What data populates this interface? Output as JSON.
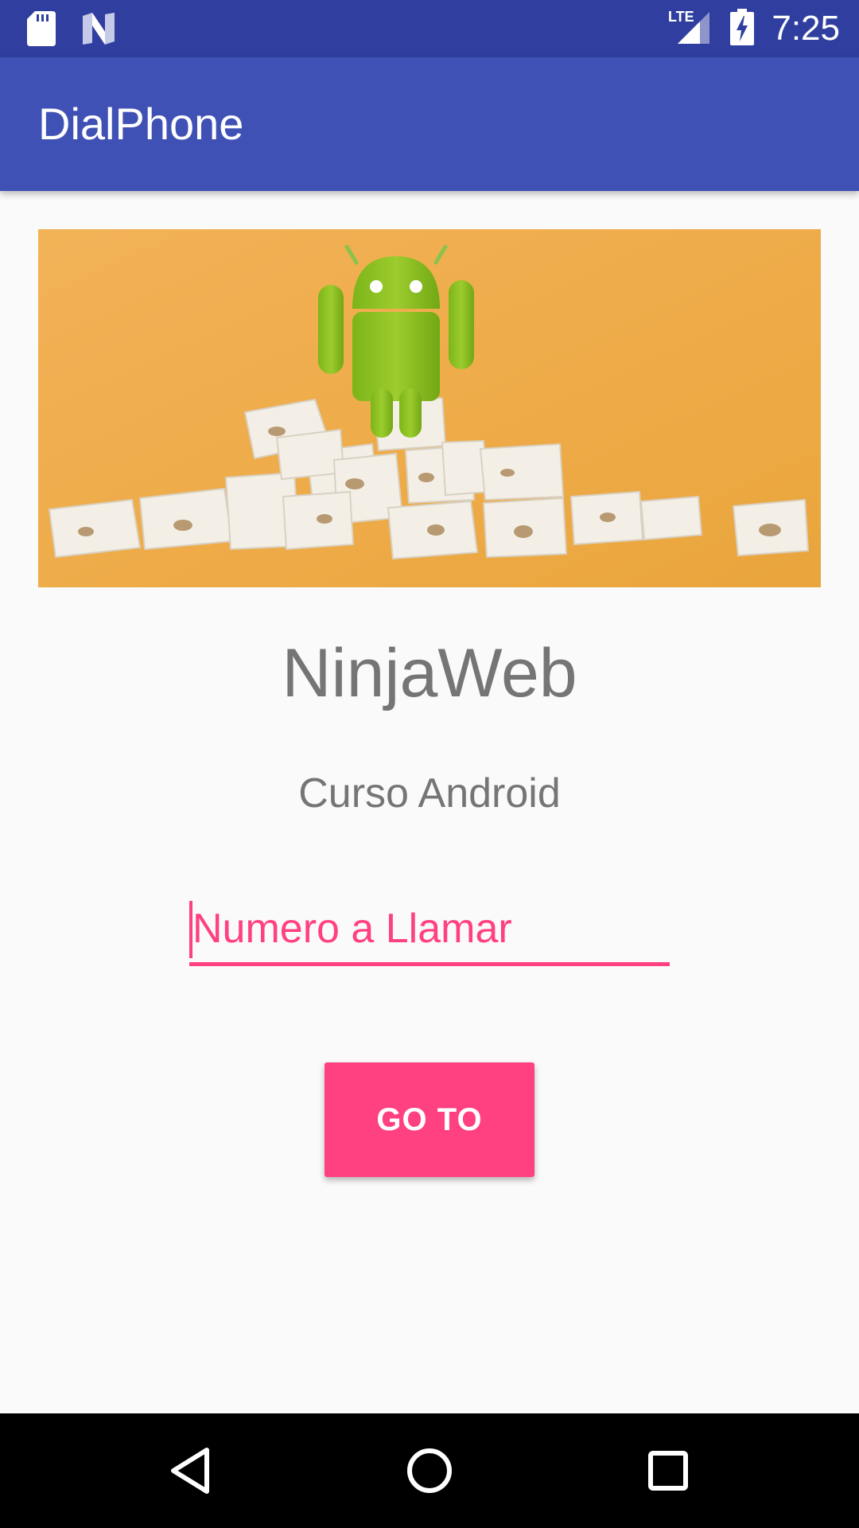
{
  "status_bar": {
    "time": "7:25",
    "network_label": "LTE",
    "icons": [
      "sd-card-icon",
      "n-logo-icon",
      "lte-signal-icon",
      "battery-charging-icon"
    ]
  },
  "app_bar": {
    "title": "DialPhone"
  },
  "hero_image": {
    "description_icon": "android-nougat-image"
  },
  "main": {
    "brand_title": "NinjaWeb",
    "subtitle": "Curso Android",
    "phone_input": {
      "placeholder": "Numero a Llamar",
      "value": ""
    },
    "go_button_label": "GO TO"
  },
  "nav_bar": {
    "icons": [
      "back-icon",
      "home-icon",
      "recents-icon"
    ]
  },
  "colors": {
    "status_bar": "#303f9f",
    "app_bar": "#3f51b5",
    "accent": "#ff4081",
    "hero_background": "#f0ad48",
    "android_green": "#8bc34a",
    "text_secondary": "#757575"
  }
}
